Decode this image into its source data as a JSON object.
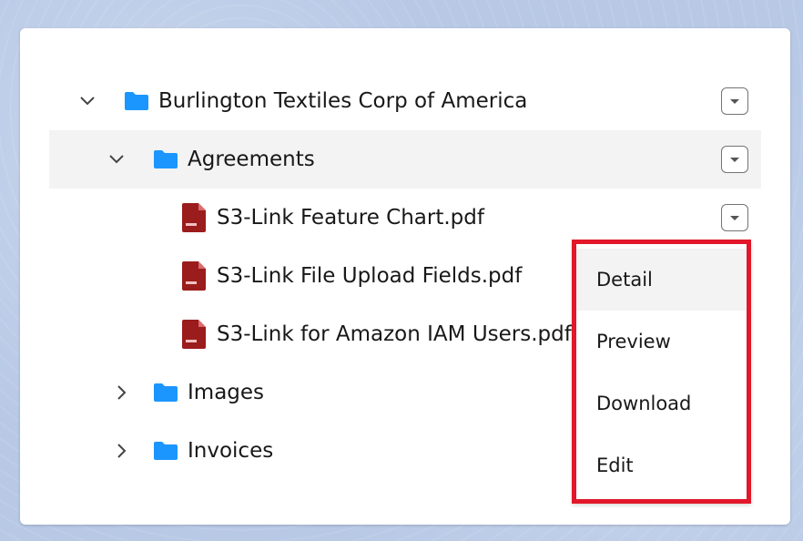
{
  "tree": {
    "root": {
      "label": "Burlington Textiles Corp of America",
      "expanded": true,
      "icon": "folder-icon"
    },
    "agreements": {
      "label": "Agreements",
      "expanded": true,
      "icon": "folder-icon",
      "selected": true
    },
    "files": [
      {
        "label": "S3-Link Feature Chart.pdf",
        "icon": "pdf-icon"
      },
      {
        "label": "S3-Link File Upload Fields.pdf",
        "icon": "pdf-icon"
      },
      {
        "label": "S3-Link for Amazon IAM Users.pdf",
        "icon": "pdf-icon"
      }
    ],
    "images": {
      "label": "Images",
      "expanded": false,
      "icon": "folder-icon"
    },
    "invoices": {
      "label": "Invoices",
      "expanded": false,
      "icon": "folder-icon"
    }
  },
  "dropdown": {
    "items": [
      {
        "label": "Detail",
        "active": true
      },
      {
        "label": "Preview"
      },
      {
        "label": "Download"
      },
      {
        "label": "Edit"
      }
    ]
  },
  "colors": {
    "folder": "#1b96ff",
    "pdf": "#9b1c1c",
    "highlight_border": "#e2182a",
    "selected_row": "#f3f3f3",
    "background": "#b8c9e6"
  }
}
